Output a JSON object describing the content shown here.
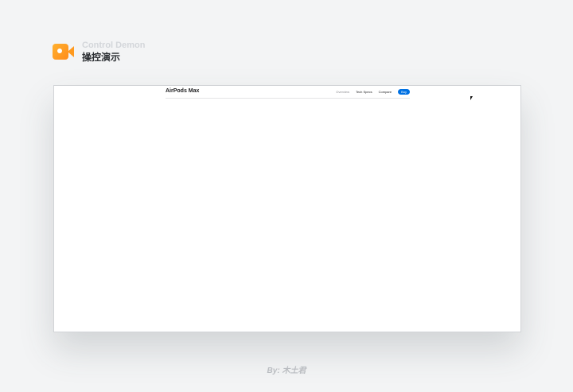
{
  "header": {
    "subtitle_en": "Control Demon",
    "title_zh": "操控演示",
    "icon": "video-camera-icon"
  },
  "browser": {
    "brand": "AirPods Max",
    "nav": {
      "overview": "Overview",
      "tech_specs": "Tech Specs",
      "compare": "Compare",
      "buy": "Buy"
    }
  },
  "footer": {
    "credit": "By: 木土君"
  },
  "colors": {
    "accent": "#0071e3",
    "icon_orange": "#ff9a1f",
    "background": "#f3f4f5"
  }
}
